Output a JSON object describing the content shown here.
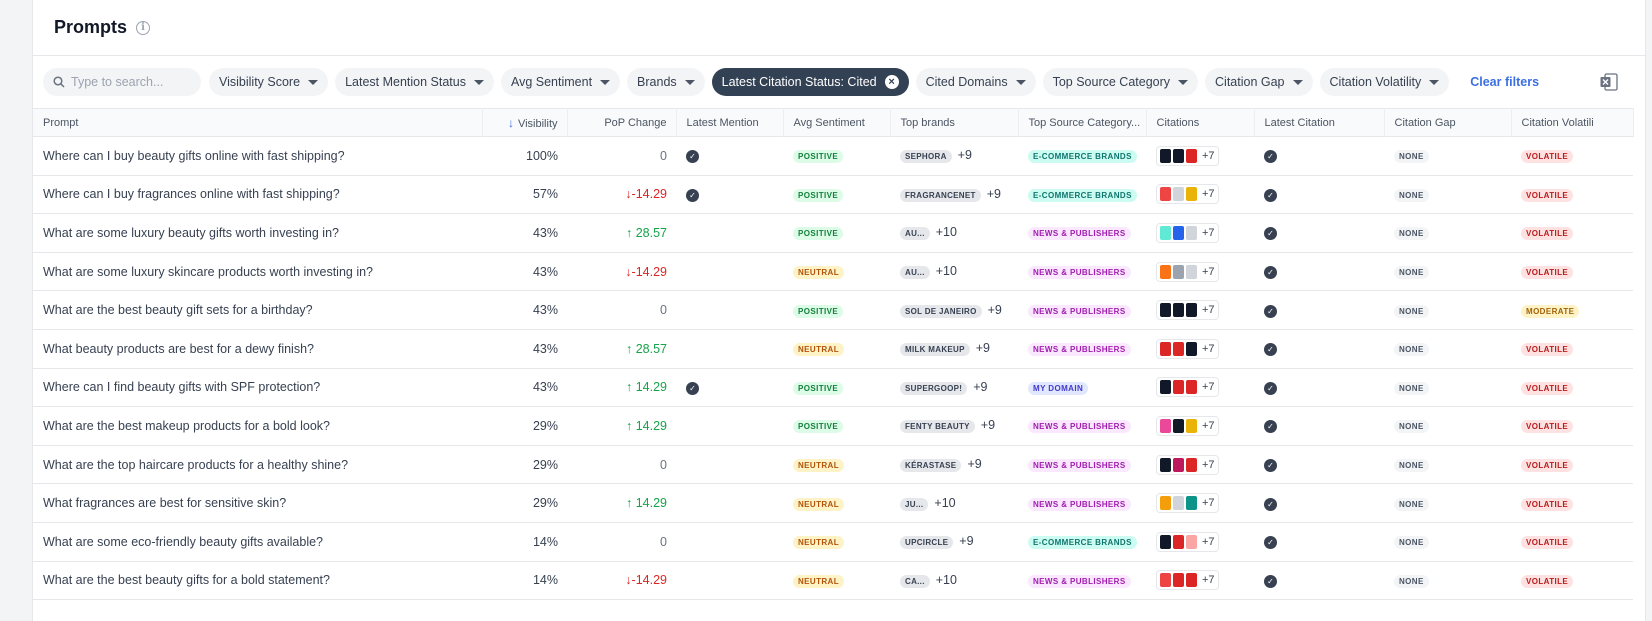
{
  "header": {
    "title": "Prompts"
  },
  "filters": {
    "search_placeholder": "Type to search...",
    "chips": [
      "Visibility Score",
      "Latest Mention Status",
      "Avg Sentiment",
      "Brands"
    ],
    "active_chip": "Latest Citation Status: Cited",
    "chips2": [
      "Cited Domains",
      "Top Source Category",
      "Citation Gap",
      "Citation Volatility"
    ],
    "clear_label": "Clear filters",
    "excel_color": "#217346"
  },
  "columns": [
    "Prompt",
    "Visibility",
    "PoP Change",
    "Latest Mention",
    "Avg Sentiment",
    "Top brands",
    "Top Source Category...",
    "Citations",
    "Latest Citation",
    "Citation Gap",
    "Citation Volatili"
  ],
  "rows": [
    {
      "prompt": "Where can I buy beauty gifts online with fast shipping?",
      "visibility": "100%",
      "pop": "0",
      "dir": "zero",
      "mention": true,
      "sentiment": "POSITIVE",
      "brand": "SEPHORA",
      "brand_more": "+9",
      "source": "E-COMMERCE BRANDS",
      "cite_more": "+7",
      "gap": "NONE",
      "volatility": "VOLATILE",
      "favs": [
        "#111827",
        "#111827",
        "#dc2626"
      ]
    },
    {
      "prompt": "Where can I buy fragrances online with fast shipping?",
      "visibility": "57%",
      "pop": "-14.29",
      "dir": "down",
      "mention": true,
      "sentiment": "POSITIVE",
      "brand": "FRAGRANCENET",
      "brand_more": "+9",
      "source": "E-COMMERCE BRANDS",
      "cite_more": "+7",
      "gap": "NONE",
      "volatility": "VOLATILE",
      "favs": [
        "#ef4444",
        "#d1d5db",
        "#eab308"
      ]
    },
    {
      "prompt": "What are some luxury beauty gifts worth investing in?",
      "visibility": "43%",
      "pop": "28.57",
      "dir": "up",
      "mention": false,
      "sentiment": "POSITIVE",
      "brand": "AU...",
      "brand_more": "+10",
      "source": "NEWS & PUBLISHERS",
      "cite_more": "+7",
      "gap": "NONE",
      "volatility": "VOLATILE",
      "favs": [
        "#5eead4",
        "#2563eb",
        "#d1d5db"
      ]
    },
    {
      "prompt": "What are some luxury skincare products worth investing in?",
      "visibility": "43%",
      "pop": "-14.29",
      "dir": "down",
      "mention": false,
      "sentiment": "NEUTRAL",
      "brand": "AU...",
      "brand_more": "+10",
      "source": "NEWS & PUBLISHERS",
      "cite_more": "+7",
      "gap": "NONE",
      "volatility": "VOLATILE",
      "favs": [
        "#f97316",
        "#9ca3af",
        "#d1d5db"
      ]
    },
    {
      "prompt": "What are the best beauty gift sets for a birthday?",
      "visibility": "43%",
      "pop": "0",
      "dir": "zero",
      "mention": false,
      "sentiment": "POSITIVE",
      "brand": "SOL DE JANEIRO",
      "brand_more": "+9",
      "source": "NEWS & PUBLISHERS",
      "cite_more": "+7",
      "gap": "NONE",
      "volatility": "MODERATE",
      "favs": [
        "#111827",
        "#111827",
        "#111827"
      ]
    },
    {
      "prompt": "What beauty products are best for a dewy finish?",
      "visibility": "43%",
      "pop": "28.57",
      "dir": "up",
      "mention": false,
      "sentiment": "NEUTRAL",
      "brand": "MILK MAKEUP",
      "brand_more": "+9",
      "source": "NEWS & PUBLISHERS",
      "cite_more": "+7",
      "gap": "NONE",
      "volatility": "VOLATILE",
      "favs": [
        "#dc2626",
        "#dc2626",
        "#111827"
      ]
    },
    {
      "prompt": "Where can I find beauty gifts with SPF protection?",
      "visibility": "43%",
      "pop": "14.29",
      "dir": "up",
      "mention": true,
      "sentiment": "POSITIVE",
      "brand": "SUPERGOOP!",
      "brand_more": "+9",
      "source": "MY DOMAIN",
      "cite_more": "+7",
      "gap": "NONE",
      "volatility": "VOLATILE",
      "favs": [
        "#111827",
        "#dc2626",
        "#dc2626"
      ]
    },
    {
      "prompt": "What are the best makeup products for a bold look?",
      "visibility": "29%",
      "pop": "14.29",
      "dir": "up",
      "mention": false,
      "sentiment": "POSITIVE",
      "brand": "FENTY BEAUTY",
      "brand_more": "+9",
      "source": "NEWS & PUBLISHERS",
      "cite_more": "+7",
      "gap": "NONE",
      "volatility": "VOLATILE",
      "favs": [
        "#ec4899",
        "#111827",
        "#eab308"
      ]
    },
    {
      "prompt": "What are the top haircare products for a healthy shine?",
      "visibility": "29%",
      "pop": "0",
      "dir": "zero",
      "mention": false,
      "sentiment": "NEUTRAL",
      "brand": "KÉRASTASE",
      "brand_more": "+9",
      "source": "NEWS & PUBLISHERS",
      "cite_more": "+7",
      "gap": "NONE",
      "volatility": "VOLATILE",
      "favs": [
        "#111827",
        "#be185d",
        "#dc2626"
      ]
    },
    {
      "prompt": "What fragrances are best for sensitive skin?",
      "visibility": "29%",
      "pop": "14.29",
      "dir": "up",
      "mention": false,
      "sentiment": "NEUTRAL",
      "brand": "JU...",
      "brand_more": "+10",
      "source": "NEWS & PUBLISHERS",
      "cite_more": "+7",
      "gap": "NONE",
      "volatility": "VOLATILE",
      "favs": [
        "#f59e0b",
        "#d1d5db",
        "#0d9488"
      ]
    },
    {
      "prompt": "What are some eco-friendly beauty gifts available?",
      "visibility": "14%",
      "pop": "0",
      "dir": "zero",
      "mention": false,
      "sentiment": "NEUTRAL",
      "brand": "UPCIRCLE",
      "brand_more": "+9",
      "source": "E-COMMERCE BRANDS",
      "cite_more": "+7",
      "gap": "NONE",
      "volatility": "VOLATILE",
      "favs": [
        "#111827",
        "#dc2626",
        "#fca5a5"
      ]
    },
    {
      "prompt": "What are the best beauty gifts for a bold statement?",
      "visibility": "14%",
      "pop": "-14.29",
      "dir": "down",
      "mention": false,
      "sentiment": "NEUTRAL",
      "brand": "CA...",
      "brand_more": "+10",
      "source": "NEWS & PUBLISHERS",
      "cite_more": "+7",
      "gap": "NONE",
      "volatility": "VOLATILE",
      "favs": [
        "#ef4444",
        "#dc2626",
        "#dc2626"
      ]
    }
  ]
}
